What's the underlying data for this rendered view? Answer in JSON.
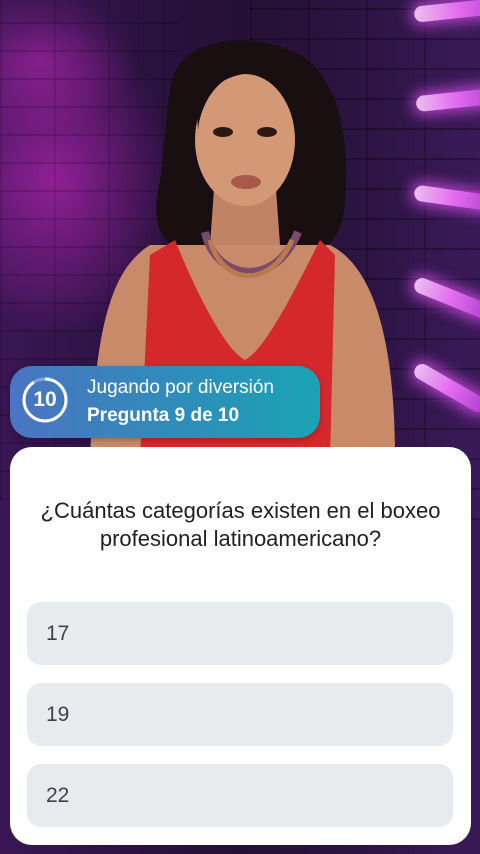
{
  "status_banner": {
    "counter": "10",
    "mode": "Jugando por diversión",
    "progress": "Pregunta 9 de 10"
  },
  "question_card": {
    "question": "¿Cuántas categorías existen en el boxeo profesional latinoamericano?",
    "options": [
      "17",
      "19",
      "22"
    ]
  },
  "colors": {
    "banner_gradient_start": "#4a74c2",
    "banner_gradient_end": "#1aa4b4",
    "card_background": "#ffffff",
    "option_background": "#e8ebee",
    "presenter_dress": "#d4282c"
  }
}
